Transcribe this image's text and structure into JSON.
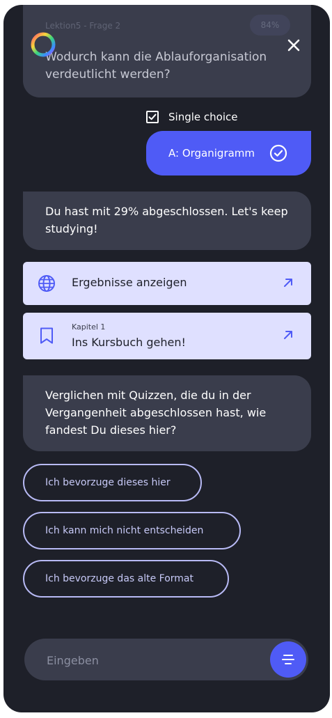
{
  "question": {
    "meta": "Lektion5 - Frage 2",
    "percent": "84%",
    "text": "Wodurch kann die Ablauforganisation verdeutlicht werden?"
  },
  "mode": {
    "label": "Single choice",
    "checked": true
  },
  "answer": {
    "label": "A: Organigramm"
  },
  "messages": [
    "Du hast mit 29% abgeschlossen. Let's keep studying!",
    "Verglichen mit Quizzen, die du in der Vergangenheit abgeschlossen hast, wie fandest Du dieses hier?"
  ],
  "links": [
    {
      "label": "Ergebnisse anzeigen",
      "icon": "globe-icon"
    },
    {
      "subtitle": "Kapitel 1",
      "label": "Ins Kursbuch gehen!",
      "icon": "bookmark-icon"
    }
  ],
  "choices": [
    "Ich bevorzuge dieses hier",
    "Ich kann mich nicht entscheiden",
    "Ich bevorzuge das alte Format"
  ],
  "input": {
    "placeholder": "Eingeben"
  },
  "colors": {
    "background": "#1e2029",
    "bubble": "#3a3d4c",
    "accent": "#4f5bf6",
    "link_card": "#dfe0ff",
    "chip_border": "#b8baf5"
  }
}
